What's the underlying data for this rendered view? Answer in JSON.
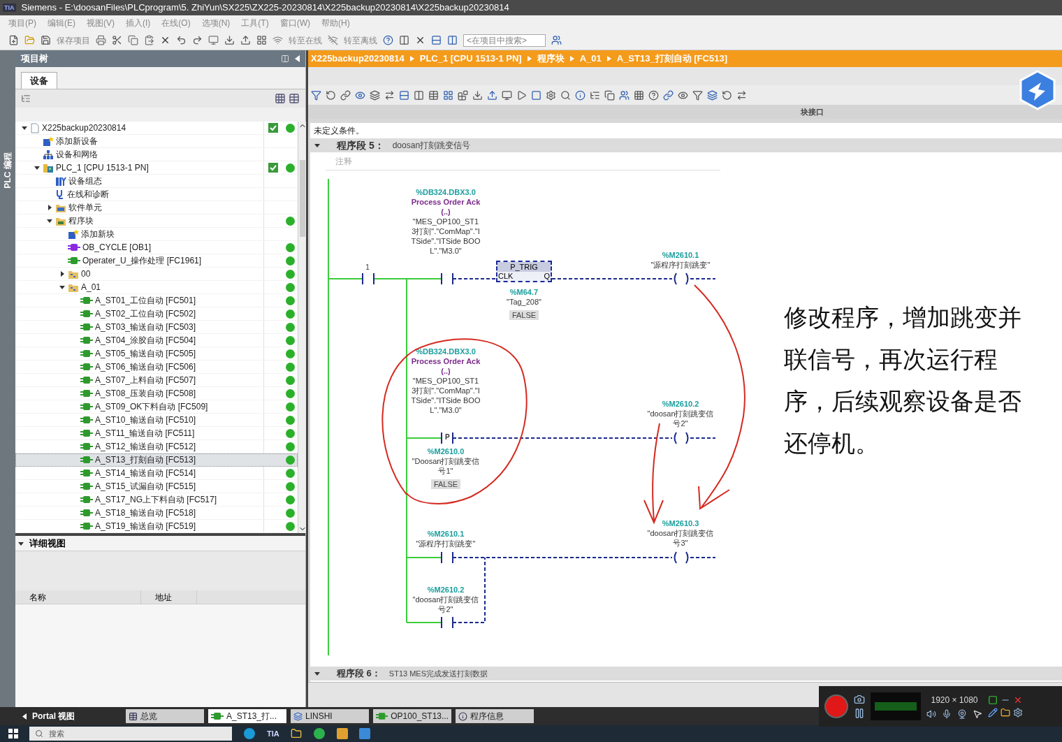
{
  "window": {
    "title": "Siemens  -  E:\\doosanFiles\\PLCprogram\\5. ZhiYun\\SX225\\ZX225-20230814\\X225backup20230814\\X225backup20230814",
    "logo": "TIA"
  },
  "menu": [
    "项目(P)",
    "编辑(E)",
    "视图(V)",
    "插入(I)",
    "在线(O)",
    "选项(N)",
    "工具(T)",
    "窗口(W)",
    "帮助(H)"
  ],
  "toolbar": {
    "save": "保存项目",
    "go_online": "转至在线",
    "go_offline": "转至离线",
    "search_placeholder": "<在项目中搜索>"
  },
  "side_strip": "PLC 编程",
  "project_tree": {
    "title": "项目树",
    "tab": "设备",
    "items": [
      {
        "label": "X225backup20230814",
        "kind": "project",
        "expanded": true,
        "selected": false,
        "compiled": true,
        "online": true,
        "children": [
          {
            "label": "添加新设备",
            "kind": "add",
            "selected": false,
            "compiled": false,
            "online": false
          },
          {
            "label": "设备和网络",
            "kind": "network",
            "selected": false,
            "compiled": false,
            "online": false
          },
          {
            "label": "PLC_1 [CPU 1513-1 PN]",
            "kind": "plc",
            "expanded": true,
            "selected": false,
            "compiled": true,
            "online": true,
            "children": [
              {
                "label": "设备组态",
                "kind": "config",
                "selected": false,
                "compiled": false,
                "online": false
              },
              {
                "label": "在线和诊断",
                "kind": "diag",
                "selected": false,
                "compiled": false,
                "online": false
              },
              {
                "label": "软件单元",
                "kind": "units",
                "expanded": false,
                "selected": false,
                "compiled": false,
                "online": false
              },
              {
                "label": "程序块",
                "kind": "blocks",
                "expanded": true,
                "selected": false,
                "compiled": false,
                "online": true,
                "children": [
                  {
                    "label": "添加新块",
                    "kind": "add",
                    "selected": false,
                    "compiled": false,
                    "online": false
                  },
                  {
                    "label": "OB_CYCLE [OB1]",
                    "kind": "ob",
                    "selected": false,
                    "compiled": false,
                    "online": true
                  },
                  {
                    "label": "Operater_U_操作处理 [FC1961]",
                    "kind": "fc",
                    "selected": false,
                    "compiled": false,
                    "online": true
                  },
                  {
                    "label": "00",
                    "kind": "group",
                    "expanded": false,
                    "selected": false,
                    "compiled": false,
                    "online": true
                  },
                  {
                    "label": "A_01",
                    "kind": "group",
                    "expanded": true,
                    "selected": false,
                    "compiled": false,
                    "online": true,
                    "children": [
                      {
                        "label": "A_ST01_工位自动 [FC501]",
                        "kind": "fc",
                        "selected": false,
                        "compiled": false,
                        "online": true
                      },
                      {
                        "label": "A_ST02_工位自动 [FC502]",
                        "kind": "fc",
                        "selected": false,
                        "compiled": false,
                        "online": true
                      },
                      {
                        "label": "A_ST03_输送自动 [FC503]",
                        "kind": "fc",
                        "selected": false,
                        "compiled": false,
                        "online": true
                      },
                      {
                        "label": "A_ST04_涂胶自动 [FC504]",
                        "kind": "fc",
                        "selected": false,
                        "compiled": false,
                        "online": true
                      },
                      {
                        "label": "A_ST05_输送自动 [FC505]",
                        "kind": "fc",
                        "selected": false,
                        "compiled": false,
                        "online": true
                      },
                      {
                        "label": "A_ST06_输送自动 [FC506]",
                        "kind": "fc",
                        "selected": false,
                        "compiled": false,
                        "online": true
                      },
                      {
                        "label": "A_ST07_上料自动 [FC507]",
                        "kind": "fc",
                        "selected": false,
                        "compiled": false,
                        "online": true
                      },
                      {
                        "label": "A_ST08_压装自动 [FC508]",
                        "kind": "fc",
                        "selected": false,
                        "compiled": false,
                        "online": true
                      },
                      {
                        "label": "A_ST09_OK下料自动 [FC509]",
                        "kind": "fc",
                        "selected": false,
                        "compiled": false,
                        "online": true
                      },
                      {
                        "label": "A_ST10_输送自动 [FC510]",
                        "kind": "fc",
                        "selected": false,
                        "compiled": false,
                        "online": true
                      },
                      {
                        "label": "A_ST11_输送自动 [FC511]",
                        "kind": "fc",
                        "selected": false,
                        "compiled": false,
                        "online": true
                      },
                      {
                        "label": "A_ST12_输送自动 [FC512]",
                        "kind": "fc",
                        "selected": false,
                        "compiled": false,
                        "online": true
                      },
                      {
                        "label": "A_ST13_打刻自动 [FC513]",
                        "kind": "fc",
                        "selected": true,
                        "compiled": false,
                        "online": true
                      },
                      {
                        "label": "A_ST14_输送自动 [FC514]",
                        "kind": "fc",
                        "selected": false,
                        "compiled": false,
                        "online": true
                      },
                      {
                        "label": "A_ST15_试漏自动 [FC515]",
                        "kind": "fc",
                        "selected": false,
                        "compiled": false,
                        "online": true
                      },
                      {
                        "label": "A_ST17_NG上下料自动 [FC517]",
                        "kind": "fc",
                        "selected": false,
                        "compiled": false,
                        "online": true
                      },
                      {
                        "label": "A_ST18_输送自动 [FC518]",
                        "kind": "fc",
                        "selected": false,
                        "compiled": false,
                        "online": true
                      },
                      {
                        "label": "A_ST19_输送自动 [FC519]",
                        "kind": "fc",
                        "selected": false,
                        "compiled": false,
                        "online": true
                      }
                    ]
                  }
                ]
              }
            ]
          }
        ]
      }
    ]
  },
  "detail_view": {
    "title": "详细视图",
    "columns": [
      "名称",
      "地址"
    ]
  },
  "editor": {
    "breadcrumb": [
      "X225backup20230814",
      "PLC_1 [CPU 1513-1 PN]",
      "程序块",
      "A_01",
      "A_ST13_打刻自动 [FC513]"
    ],
    "interface_label": "块接口",
    "condition": "未定义条件。",
    "network": {
      "label": "程序段 5：",
      "title": "doosan打刻跳变信号",
      "comment": "注释",
      "expanded": true,
      "elements": [
        {
          "kind": "contact",
          "operand": "1"
        },
        {
          "kind": "contact",
          "address": "%DB324.DBX3.0",
          "comment": "Process Order Ack (..)",
          "symbol": "\"MES_OP100_ST13打刻\".\"ComMap\".\"ITSide\".\"ITSide BOOL\".\"M3.0\""
        },
        {
          "kind": "p_trig",
          "title": "P_TRIG",
          "pin_in": "CLK",
          "pin_out": "Q",
          "address": "%M64.7",
          "symbol": "\"Tag_208\"",
          "value": "FALSE"
        },
        {
          "kind": "coil",
          "address": "%M2610.1",
          "symbol": "\"源程序打刻跳变\""
        },
        {
          "kind": "p_contact",
          "letter": "P",
          "address": "%DB324.DBX3.0",
          "comment": "Process Order Ack (..)",
          "symbol": "\"MES_OP100_ST13打刻\".\"ComMap\".\"ITSide\".\"ITSide BOOL\".\"M3.0\"",
          "edge_address": "%M2610.0",
          "edge_symbol": "\"Doosan打刻跳变信号1\"",
          "value": "FALSE"
        },
        {
          "kind": "coil",
          "address": "%M2610.2",
          "symbol": "\"doosan打刻跳变信号2\""
        },
        {
          "kind": "contact",
          "address": "%M2610.1",
          "symbol": "\"源程序打刻跳变\""
        },
        {
          "kind": "coil",
          "address": "%M2610.3",
          "symbol": "\"doosan打刻跳变信号3\""
        },
        {
          "kind": "contact",
          "address": "%M2610.2",
          "symbol": "\"doosan打刻跳变信号2\""
        }
      ]
    },
    "next_network": {
      "label": "程序段 6：",
      "title": "ST13 MES完成发送打刻数据"
    }
  },
  "annotation": "修改程序，增加跳变并联信号，再次运行程序，后续观察设备是否还停机。",
  "portal_bar": {
    "portal": "Portal 视图",
    "tabs": [
      {
        "label": "总览",
        "kind": "overview",
        "selected": false
      },
      {
        "label": "A_ST13_打...",
        "kind": "block",
        "selected": true
      },
      {
        "label": "LINSHI",
        "kind": "table",
        "selected": false
      },
      {
        "label": "OP100_ST13...",
        "kind": "block",
        "selected": false
      },
      {
        "label": "程序信息",
        "kind": "info",
        "selected": false
      }
    ]
  },
  "recorder": {
    "resolution": "1920 × 1080"
  },
  "taskbar": {
    "search_placeholder": "搜索",
    "apps": [
      "TIA"
    ]
  }
}
